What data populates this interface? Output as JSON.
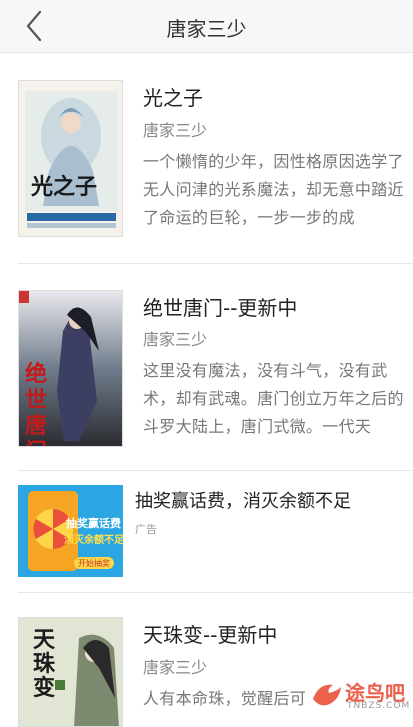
{
  "header": {
    "title": "唐家三少",
    "back_icon": "chevron-left-icon"
  },
  "books": [
    {
      "title": "光之子",
      "author": "唐家三少",
      "description": "一个懒惰的少年，因性格原因选学了无人问津的光系魔法，却无意中踏近了命运的巨轮，一步一步的成",
      "cover_text": "光之子"
    },
    {
      "title": "绝世唐门--更新中",
      "author": "唐家三少",
      "description": "这里没有魔法，没有斗气，没有武术，却有武魂。唐门创立万年之后的斗罗大陆上，唐门式微。一代天",
      "cover_text": "绝世唐门"
    },
    {
      "title": "天珠变--更新中",
      "author": "唐家三少",
      "description": "人有本命珠，觉醒后可",
      "cover_text": "天珠变"
    }
  ],
  "ad": {
    "title": "抽奖赢话费，消灭余额不足",
    "tag": "广告",
    "banner_line1": "抽奖赢话费",
    "banner_line2": "消灭余额不足",
    "banner_button": "开始抽奖"
  },
  "watermark": {
    "text": "途鸟吧",
    "sub": "TNBZS.COM"
  },
  "colors": {
    "accent_red": "#e8452d",
    "text_dark": "#222222",
    "text_gray": "#777777"
  }
}
